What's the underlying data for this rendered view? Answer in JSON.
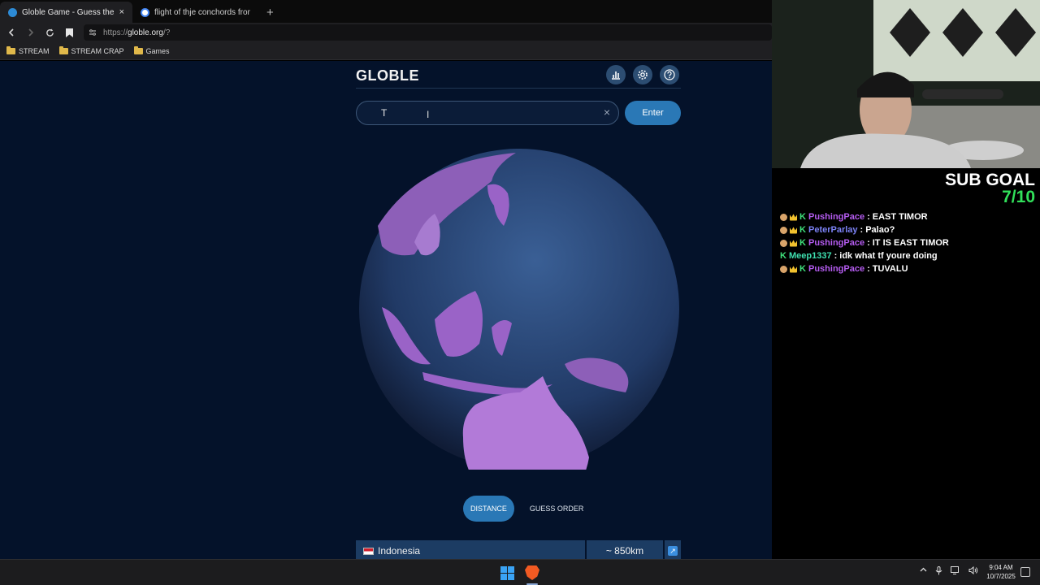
{
  "browser": {
    "tabs": [
      {
        "title": "Globle Game - Guess the Countr",
        "active": true
      },
      {
        "title": "flight of thje conchords from - Goog",
        "active": false
      }
    ],
    "new_tab_symbol": "+",
    "close_symbol": "×",
    "url_scheme": "https://",
    "url_host": "globle.org",
    "url_path": "/?",
    "bookmarks": [
      "STREAM",
      "STREAM CRAP",
      "Games"
    ]
  },
  "page": {
    "logo": "GLOBLE",
    "icons": [
      "stats-icon",
      "settings-icon",
      "help-icon"
    ],
    "search": {
      "value": "T",
      "clear_symbol": "×"
    },
    "enter_label": "Enter",
    "toggle": {
      "distance": "DISTANCE",
      "guess_order": "GUESS ORDER",
      "selected": "DISTANCE"
    },
    "results": [
      {
        "country": "Indonesia",
        "distance": "~ 850km",
        "direction": "↗"
      }
    ],
    "colors": {
      "background": "#04122a",
      "accent": "#2a78b6",
      "guessed_country": "#9a63c7",
      "ocean": "#24406e"
    }
  },
  "stream": {
    "sub_goal_label": "SUB GOAL",
    "sub_goal_count": "7/10",
    "chat": [
      {
        "user": "PushingPace",
        "text": "EAST TIMOR",
        "color": "#b55cf0",
        "badges": [
          "face",
          "crown",
          "k"
        ]
      },
      {
        "user": "PeterParlay",
        "text": "Palao?",
        "color": "#7c82f5",
        "badges": [
          "face",
          "crown",
          "k"
        ]
      },
      {
        "user": "PushingPace",
        "text": "IT IS EAST TIMOR",
        "color": "#b55cf0",
        "badges": [
          "face",
          "crown",
          "k"
        ]
      },
      {
        "user": "Meep1337",
        "text": "idk what tf youre doing",
        "color": "#3fe0b0",
        "badges": [
          "k"
        ]
      },
      {
        "user": "PushingPace",
        "text": "TUVALU",
        "color": "#b55cf0",
        "badges": [
          "face",
          "crown",
          "k"
        ]
      }
    ]
  },
  "taskbar": {
    "time": "9:04 AM",
    "date": "10/7/2025",
    "tray_icons": [
      "chevron-up-icon",
      "microphone-icon",
      "network-icon",
      "volume-icon"
    ]
  }
}
